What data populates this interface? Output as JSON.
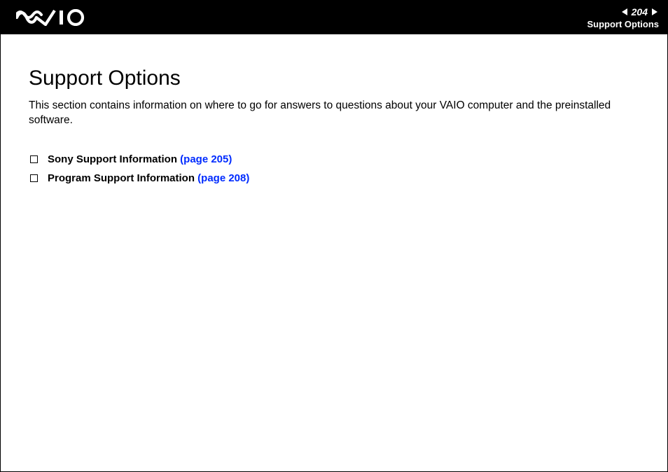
{
  "header": {
    "page_number": "204",
    "section_label": "Support Options"
  },
  "main": {
    "title": "Support Options",
    "intro": "This section contains information on where to go for answers to questions about your VAIO computer and the preinstalled software.",
    "items": [
      {
        "text": "Sony Support Information",
        "link": "(page 205)"
      },
      {
        "text": "Program Support Information",
        "link": "(page 208)"
      }
    ]
  }
}
